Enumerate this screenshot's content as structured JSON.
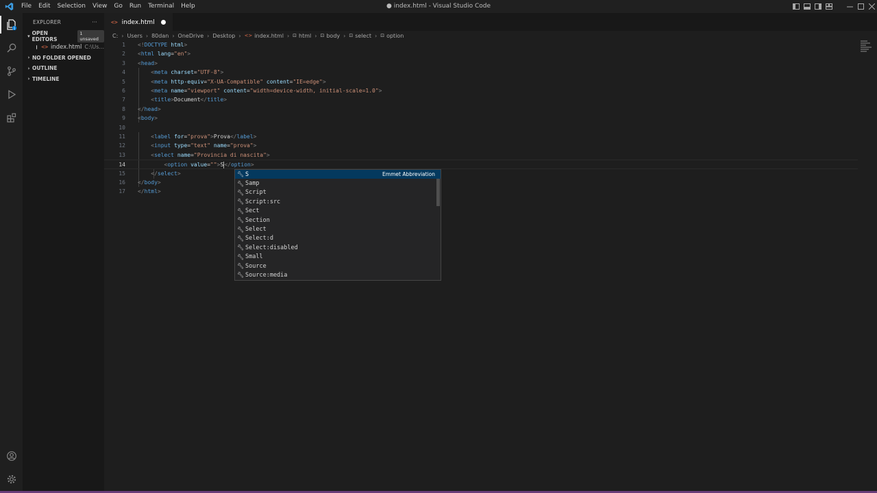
{
  "window": {
    "title": "● index.html - Visual Studio Code"
  },
  "menu": [
    "File",
    "Edit",
    "Selection",
    "View",
    "Go",
    "Run",
    "Terminal",
    "Help"
  ],
  "explorer": {
    "header": "EXPLORER",
    "more": "···",
    "open_editors": {
      "label": "OPEN EDITORS",
      "badge": "1 unsaved"
    },
    "open_file": {
      "name": "index.html",
      "path": "C:\\Us..."
    },
    "sections": [
      "NO FOLDER OPENED",
      "OUTLINE",
      "TIMELINE"
    ]
  },
  "tab": {
    "name": "index.html",
    "icon": "<>"
  },
  "breadcrumb": [
    "C:",
    "Users",
    "80dan",
    "OneDrive",
    "Desktop",
    "index.html",
    "html",
    "body",
    "select",
    "option"
  ],
  "code": {
    "line_numbers": [
      "1",
      "2",
      "3",
      "4",
      "5",
      "6",
      "7",
      "8",
      "9",
      "10",
      "11",
      "12",
      "13",
      "14",
      "15",
      "16",
      "17"
    ],
    "current_line": "14"
  },
  "suggest": {
    "detail": "Emmet Abbreviation",
    "items": [
      "S",
      "Samp",
      "Script",
      "Script:src",
      "Sect",
      "Section",
      "Select",
      "Select:d",
      "Select:disabled",
      "Small",
      "Source",
      "Source:media"
    ]
  },
  "colors": {
    "accent": "#04395e",
    "tag": "#569cd6",
    "attr": "#9cdcfe",
    "string": "#ce9178"
  }
}
